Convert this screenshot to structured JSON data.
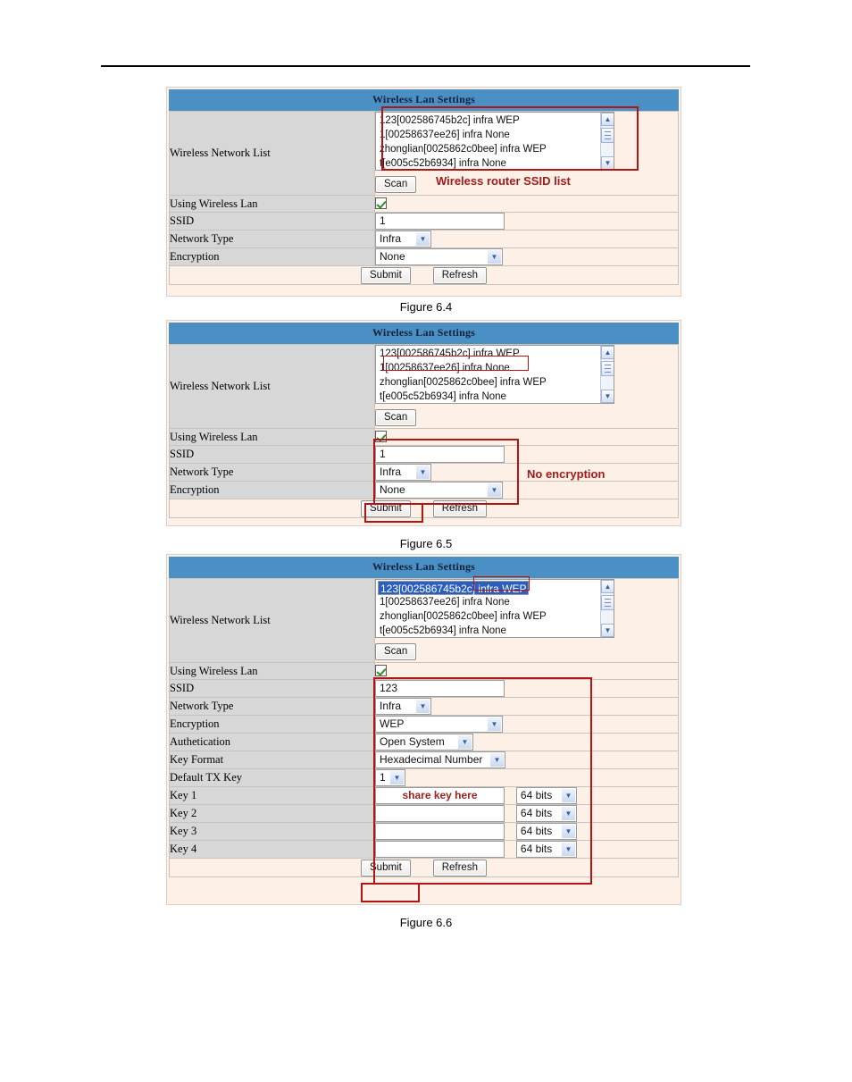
{
  "document": {
    "captions": [
      "Figure 6.4",
      "Figure 6.5",
      "Figure 6.6"
    ]
  },
  "colors": {
    "header_blue": "#4a90c4",
    "panel_bg": "#fdf1e7",
    "label_bg": "#d7d7d7",
    "annotation_red": "#a11b1b",
    "highlight_blue": "#2a5fc0"
  },
  "common": {
    "panel_title": "Wireless Lan Settings",
    "labels": {
      "wireless_network_list": "Wireless Network List",
      "using_wireless_lan": "Using Wireless Lan",
      "ssid": "SSID",
      "network_type": "Network Type",
      "encryption": "Encryption",
      "authetication": "Authetication",
      "key_format": "Key Format",
      "default_tx_key": "Default TX Key",
      "key1": "Key 1",
      "key2": "Key 2",
      "key3": "Key 3",
      "key4": "Key 4"
    },
    "buttons": {
      "scan": "Scan",
      "submit": "Submit",
      "refresh": "Refresh"
    },
    "network_list": [
      "123[002586745b2c]  infra WEP",
      "1[00258637ee26] infra None",
      "zhonglian[0025862c0bee] infra WEP",
      "t[e005c52b6934] infra None"
    ],
    "scrollbar": {
      "up_arrow": "▲",
      "down_arrow": "▼"
    }
  },
  "fig64": {
    "title": "Wireless Lan Settings",
    "using_wireless_lan_checked": true,
    "ssid_value": "1",
    "network_type_value": "Infra",
    "encryption_value": "None",
    "annotation": "Wireless router SSID list"
  },
  "fig65": {
    "title": "Wireless Lan Settings",
    "using_wireless_lan_checked": true,
    "ssid_value": "1",
    "network_type_value": "Infra",
    "encryption_value": "None",
    "annotation": "No encryption",
    "highlighted_list_item": "1[00258637ee26] infra None"
  },
  "fig66": {
    "title": "Wireless Lan Settings",
    "selected_list_item": "123[002586745b2c]  infra WEP",
    "using_wireless_lan_checked": true,
    "ssid_value": "123",
    "network_type_value": "Infra",
    "encryption_value": "WEP",
    "authetication_value": "Open System",
    "key_format_value": "Hexadecimal Number",
    "default_tx_key_value": "1",
    "key1_value": "share key here",
    "key2_value": "",
    "key3_value": "",
    "key4_value": "",
    "key1_bits": "64 bits",
    "key2_bits": "64 bits",
    "key3_bits": "64 bits",
    "key4_bits": "64 bits"
  }
}
